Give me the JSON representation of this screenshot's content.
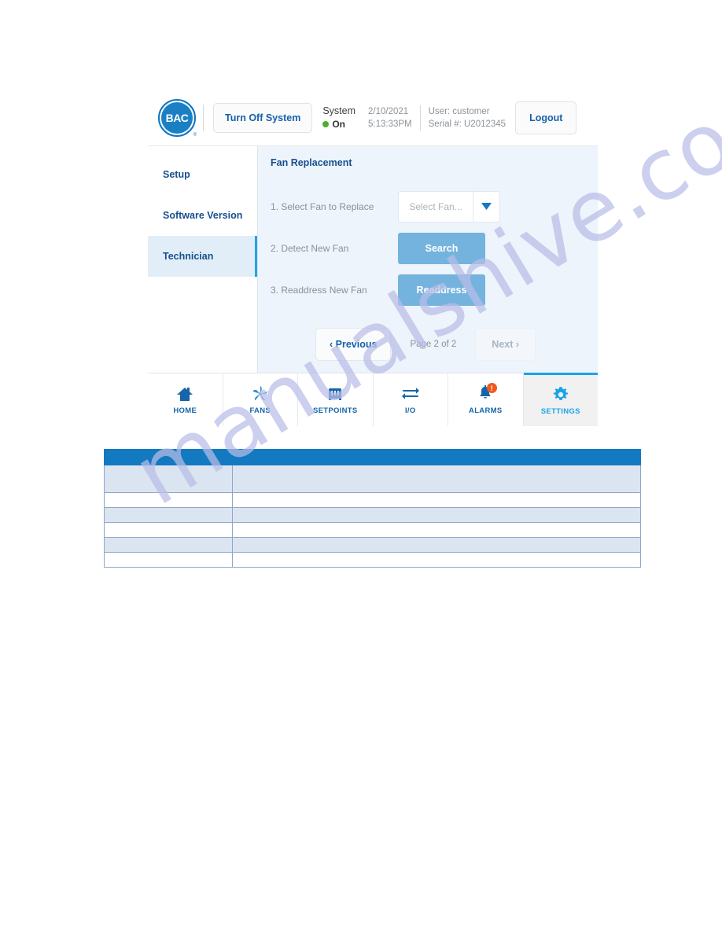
{
  "device": {
    "header": {
      "logo_text": "BAC",
      "logo_reg": "®",
      "turn_off_label": "Turn Off System",
      "system_label": "System",
      "system_state": "On",
      "date": "2/10/2021",
      "time": "5:13:33PM",
      "user": "User: customer",
      "serial": "Serial #: U2012345",
      "logout_label": "Logout"
    },
    "sidebar": {
      "items": [
        {
          "label": "Setup",
          "active": false
        },
        {
          "label": "Software Version",
          "active": false
        },
        {
          "label": "Technician",
          "active": true
        }
      ]
    },
    "content": {
      "title": "Fan Replacement",
      "steps": [
        {
          "label": "1. Select Fan to Replace",
          "control": "dropdown",
          "value": "Select Fan..."
        },
        {
          "label": "2. Detect New Fan",
          "control": "button",
          "value": "Search"
        },
        {
          "label": "3. Readdress New Fan",
          "control": "button",
          "value": "Readdress"
        }
      ],
      "pager": {
        "previous_label": "Previous",
        "previous_chevron": "‹",
        "page_text": "Page 2 of 2",
        "next_label": "Next",
        "next_chevron": "›"
      }
    },
    "nav": {
      "items": [
        {
          "label": "HOME",
          "icon": "home-icon",
          "active": false,
          "badge": ""
        },
        {
          "label": "FANS",
          "icon": "fan-icon",
          "active": false,
          "badge": ""
        },
        {
          "label": "SETPOINTS",
          "icon": "sliders-icon",
          "active": false,
          "badge": ""
        },
        {
          "label": "I/O",
          "icon": "exchange-arrows-icon",
          "active": false,
          "badge": ""
        },
        {
          "label": "ALARMS",
          "icon": "bell-icon",
          "active": false,
          "badge": "!"
        },
        {
          "label": "SETTINGS",
          "icon": "gear-icon",
          "active": true,
          "badge": ""
        }
      ]
    },
    "colors": {
      "brand_blue": "#1379c0",
      "accent_blue": "#1aa3e8",
      "panel_bg": "#eef4fb",
      "button_blue": "#74b3de",
      "status_green": "#4caf2e",
      "badge_orange": "#ef5a1a"
    }
  },
  "table": {
    "header_cells": [
      "",
      ""
    ],
    "rows": [
      {
        "cells": [
          "",
          ""
        ],
        "height": 35,
        "shade": true
      },
      {
        "cells": [
          "",
          ""
        ],
        "height": 19,
        "shade": false
      },
      {
        "cells": [
          "",
          ""
        ],
        "height": 19,
        "shade": true
      },
      {
        "cells": [
          "",
          ""
        ],
        "height": 19,
        "shade": false
      },
      {
        "cells": [
          "",
          ""
        ],
        "height": 19,
        "shade": true
      },
      {
        "cells": [
          "",
          ""
        ],
        "height": 19,
        "shade": false
      }
    ]
  },
  "watermark": {
    "text": "manualshive.com"
  }
}
